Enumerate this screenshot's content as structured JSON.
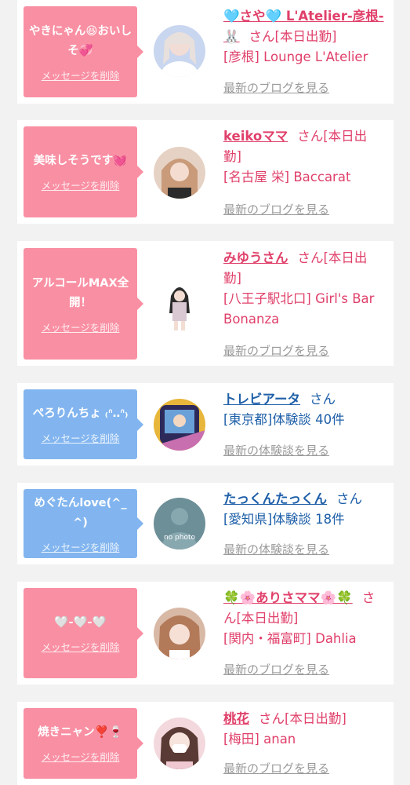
{
  "cards": [
    {
      "message": "やきにゃん😆おいしそ💞",
      "delete": "メッセージを削除",
      "name": "🩵さや🩵 L'Atelier-彦根-🐰",
      "san": "さん[本日出勤]",
      "shop": "[彦根] Lounge L'Atelier",
      "link": "最新のブログを見る"
    },
    {
      "message": "美味しそうです💓",
      "delete": "メッセージを削除",
      "name": "keikoママ",
      "san": "さん[本日出勤]",
      "shop": "[名古屋 栄] Baccarat",
      "link": "最新のブログを見る"
    },
    {
      "message": "アルコールMAX全開！",
      "delete": "メッセージを削除",
      "name": "みゆうさん",
      "san": "さん[本日出勤]",
      "shop": "[八王子駅北口] Girl's Bar Bonanza",
      "link": "最新のブログを見る"
    },
    {
      "message": "ぺろりんちょ ₍ᐢ‥ᐢ₎",
      "delete": "メッセージを削除",
      "name": "トレビアータ",
      "san": "さん",
      "shop": "[東京都]体験談 40件",
      "link": "最新の体験談を見る"
    },
    {
      "message": "めぐたんlove(^_^)",
      "delete": "メッセージを削除",
      "name": "たっくんたっくん",
      "san": "さん",
      "shop": "[愛知県]体験談 18件",
      "link": "最新の体験談を見る",
      "avatar_text": "no photo"
    },
    {
      "message": "🤍-🤍-🤍",
      "delete": "メッセージを削除",
      "name": "🍀🌸ありさママ🌸🍀",
      "san": "さん[本日出勤]",
      "shop": "[関内・福富町] Dahlia",
      "link": "最新のブログを見る"
    },
    {
      "message": "焼きニャン❣️🍷",
      "delete": "メッセージを削除",
      "name": "桃花",
      "san": "さん[本日出勤]",
      "shop": "[梅田] anan",
      "link": "最新のブログを見る"
    }
  ],
  "colors": {
    "pink_bubble": "#f98fa3",
    "blue_bubble": "#82b5ef",
    "pink_text": "#e0406a",
    "blue_text": "#1e5fa8",
    "link_gray": "#9a9a9a"
  }
}
